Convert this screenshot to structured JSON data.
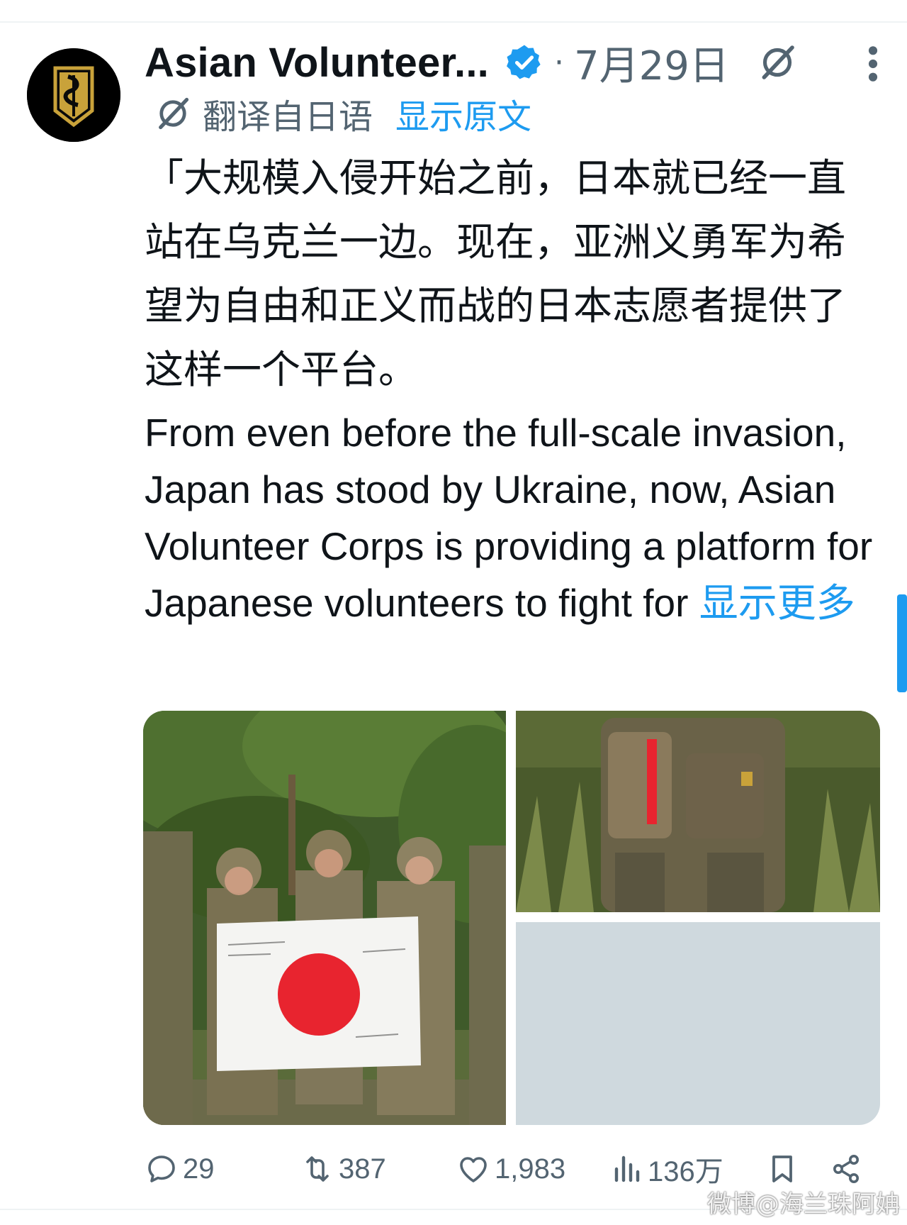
{
  "tweet": {
    "display_name": "Asian Volunteer...",
    "timestamp": "7月29日",
    "dot": "·",
    "translated_from": "翻译自日语",
    "show_original": "显示原文",
    "text_zh": "「大规模入侵开始之前，日本就已经一直站在乌克兰一边。现在，亚洲义勇军为希望为自由和正义而战的日本志愿者提供了这样一个平台。",
    "text_en": "From even before the full-scale invasion, Japan has stood by Ukraine, now, Asian Volunteer Corps is providing a platform for Japanese volunteers to fight for ",
    "show_more": "显示更多"
  },
  "metrics": {
    "replies": "29",
    "retweets": "387",
    "likes": "1,983",
    "views": "136万"
  },
  "watermark": "微博@海兰珠阿姌",
  "colors": {
    "accent": "#1d9bf0",
    "muted": "#536471",
    "text": "#0f1419",
    "placeholder": "#cfd9de",
    "flag_red": "#e8242f"
  },
  "icons": {
    "verified": "verified-badge-icon",
    "grok": "grok-icon",
    "more": "more-icon",
    "reply": "reply-icon",
    "retweet": "retweet-icon",
    "like": "heart-icon",
    "views": "views-icon",
    "bookmark": "bookmark-icon",
    "share": "share-icon"
  }
}
